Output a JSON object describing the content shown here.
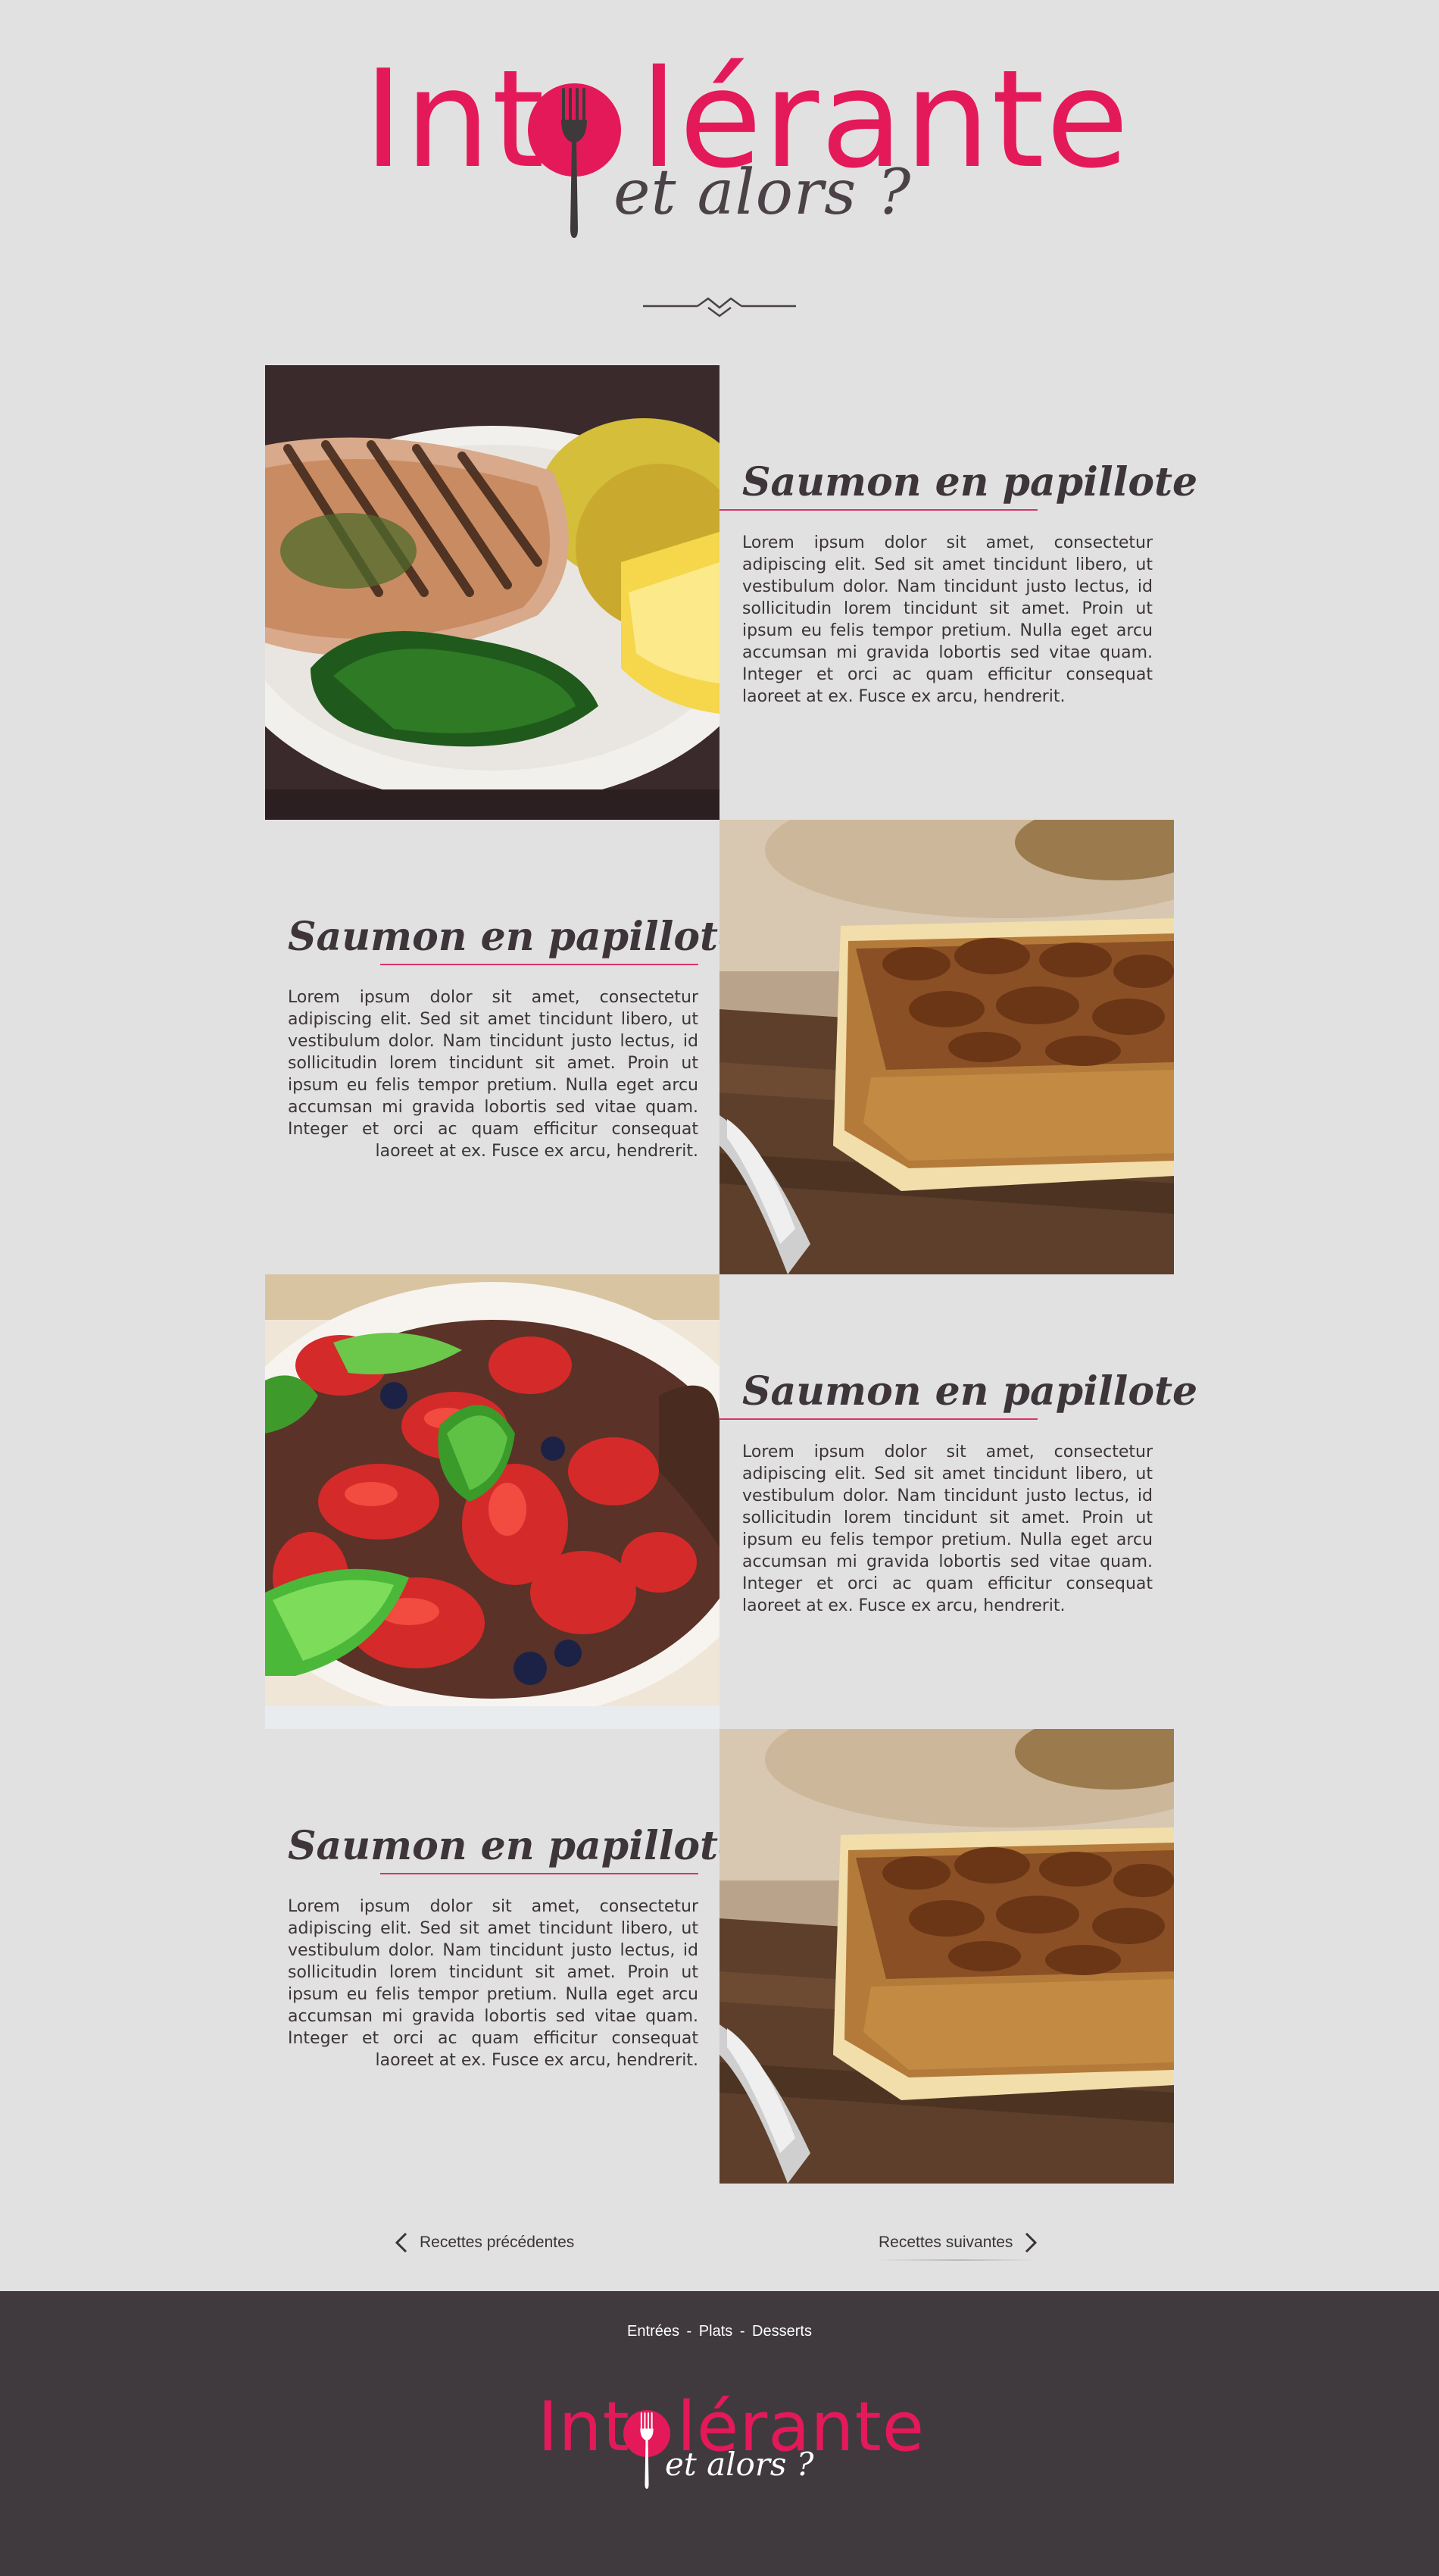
{
  "brand": {
    "title_before": "Int",
    "title_after": "lérante",
    "tagline": "et alors ?"
  },
  "recipes": [
    {
      "title": "Saumon en papillote",
      "body": "Lorem ipsum dolor sit amet, consectetur adipiscing elit. Sed sit amet tincidunt libero, ut vestibulum dolor. Nam tincidunt justo lectus, id sollicitudin lorem tincidunt sit amet. Proin ut ipsum eu felis tempor pretium. Nulla eget arcu accumsan mi gravida lobortis sed vitae quam. Integer et orci ac quam efficitur consequat laoreet at ex. Fusce ex arcu, hendrerit.",
      "image": "grilled-salmon-plate"
    },
    {
      "title": "Saumon en papillote",
      "body": "Lorem ipsum dolor sit amet, consectetur adipiscing elit. Sed sit amet tincidunt libero, ut vestibulum dolor. Nam tincidunt justo lectus, id sollicitudin lorem tincidunt sit amet. Proin ut ipsum eu felis tempor pretium. Nulla eget arcu accumsan mi gravida lobortis sed vitae quam. Integer et orci ac quam efficitur consequat laoreet at ex. Fusce ex arcu, hendrerit.",
      "image": "pecan-pie-slice"
    },
    {
      "title": "Saumon en papillote",
      "body": "Lorem ipsum dolor sit amet, consectetur adipiscing elit. Sed sit amet tincidunt libero, ut vestibulum dolor. Nam tincidunt justo lectus, id sollicitudin lorem tincidunt sit amet. Proin ut ipsum eu felis tempor pretium. Nulla eget arcu accumsan mi gravida lobortis sed vitae quam. Integer et orci ac quam efficitur consequat laoreet at ex. Fusce ex arcu, hendrerit.",
      "image": "strawberry-fruit-salad"
    },
    {
      "title": "Saumon en papillote",
      "body": "Lorem ipsum dolor sit amet, consectetur adipiscing elit. Sed sit amet tincidunt libero, ut vestibulum dolor. Nam tincidunt justo lectus, id sollicitudin lorem tincidunt sit amet. Proin ut ipsum eu felis tempor pretium. Nulla eget arcu accumsan mi gravida lobortis sed vitae quam. Integer et orci ac quam efficitur consequat laoreet at ex. Fusce ex arcu, hendrerit.",
      "image": "pecan-pie-slice"
    }
  ],
  "pagination": {
    "prev_label": "Recettes précédentes",
    "next_label": "Recettes suivantes",
    "prev_icon": "chevron-left-icon",
    "next_icon": "chevron-right-icon"
  },
  "footer": {
    "nav": [
      "Entrées",
      "Plats",
      "Desserts"
    ],
    "separator": "-"
  },
  "colors": {
    "brand_pink": "#e4195a",
    "background": "#e2e1e2",
    "footer_bg": "#403a3e",
    "text_dark": "#3a3337"
  }
}
